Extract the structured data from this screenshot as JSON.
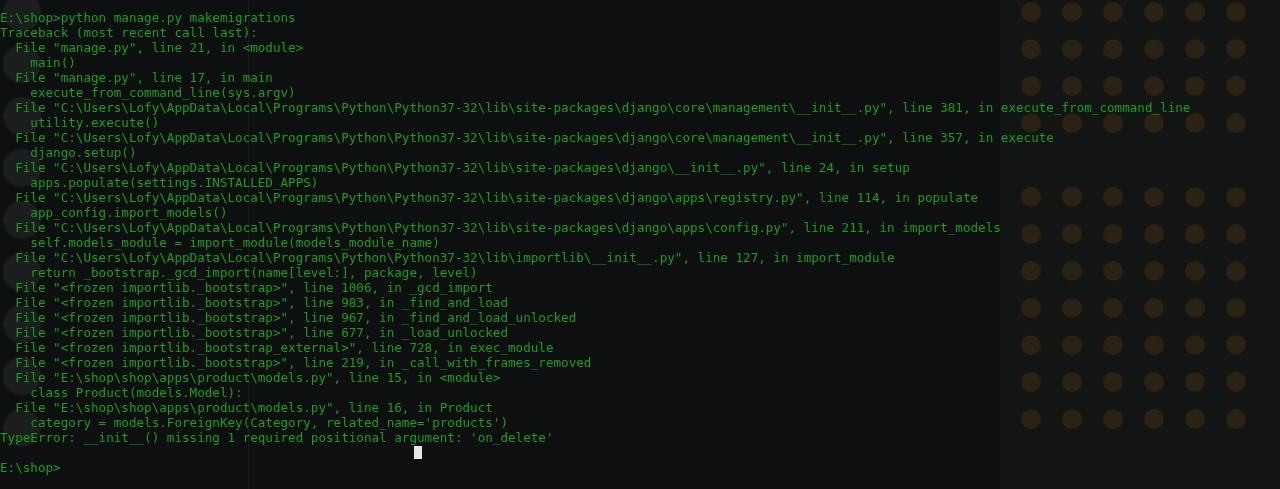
{
  "terminal": {
    "lines": [
      "E:\\shop>python manage.py makemigrations",
      "Traceback (most recent call last):",
      "  File \"manage.py\", line 21, in <module>",
      "    main()",
      "  File \"manage.py\", line 17, in main",
      "    execute_from_command_line(sys.argv)",
      "  File \"C:\\Users\\Lofy\\AppData\\Local\\Programs\\Python\\Python37-32\\lib\\site-packages\\django\\core\\management\\__init__.py\", line 381, in execute_from_command_line",
      "    utility.execute()",
      "  File \"C:\\Users\\Lofy\\AppData\\Local\\Programs\\Python\\Python37-32\\lib\\site-packages\\django\\core\\management\\__init__.py\", line 357, in execute",
      "    django.setup()",
      "  File \"C:\\Users\\Lofy\\AppData\\Local\\Programs\\Python\\Python37-32\\lib\\site-packages\\django\\__init__.py\", line 24, in setup",
      "    apps.populate(settings.INSTALLED_APPS)",
      "  File \"C:\\Users\\Lofy\\AppData\\Local\\Programs\\Python\\Python37-32\\lib\\site-packages\\django\\apps\\registry.py\", line 114, in populate",
      "    app_config.import_models()",
      "  File \"C:\\Users\\Lofy\\AppData\\Local\\Programs\\Python\\Python37-32\\lib\\site-packages\\django\\apps\\config.py\", line 211, in import_models",
      "    self.models_module = import_module(models_module_name)",
      "  File \"C:\\Users\\Lofy\\AppData\\Local\\Programs\\Python\\Python37-32\\lib\\importlib\\__init__.py\", line 127, in import_module",
      "    return _bootstrap._gcd_import(name[level:], package, level)",
      "  File \"<frozen importlib._bootstrap>\", line 1006, in _gcd_import",
      "  File \"<frozen importlib._bootstrap>\", line 983, in _find_and_load",
      "  File \"<frozen importlib._bootstrap>\", line 967, in _find_and_load_unlocked",
      "  File \"<frozen importlib._bootstrap>\", line 677, in _load_unlocked",
      "  File \"<frozen importlib._bootstrap_external>\", line 728, in exec_module",
      "  File \"<frozen importlib._bootstrap>\", line 219, in _call_with_frames_removed",
      "  File \"E:\\shop\\shop\\apps\\product\\models.py\", line 15, in <module>",
      "    class Product(models.Model):",
      "  File \"E:\\shop\\shop\\apps\\product\\models.py\", line 16, in Product",
      "    category = models.ForeignKey(Category, related_name='products')",
      "TypeError: __init__() missing 1 required positional argument: 'on_delete'"
    ],
    "prompt": "E:\\shop>"
  }
}
